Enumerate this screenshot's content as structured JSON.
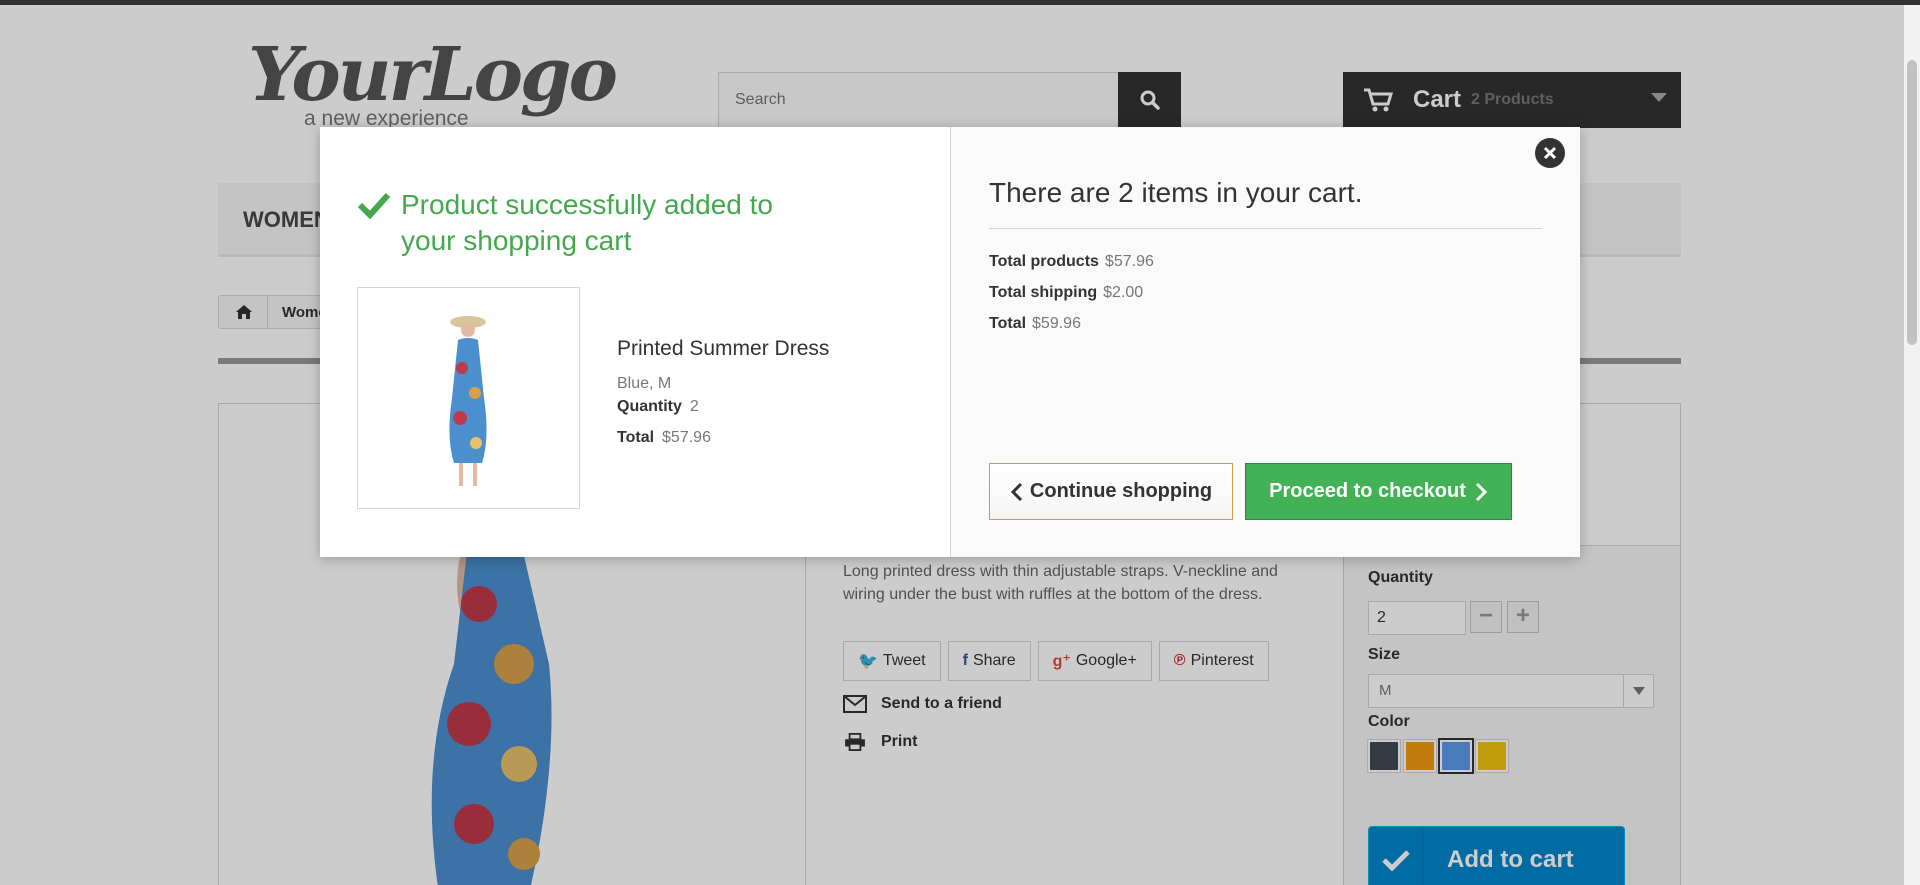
{
  "header": {
    "logo_script": "YourLogo",
    "logo_tagline": "a new experience",
    "search_placeholder": "Search",
    "cart_label": "Cart",
    "cart_count": "2 Products"
  },
  "menu": {
    "first_item": "WOMEN"
  },
  "breadcrumb": {
    "first_crumb": "Women"
  },
  "product": {
    "description": "Long printed dress with thin adjustable straps. V-neckline and wiring under the bust with ruffles at the bottom of the dress.",
    "social": [
      "Tweet",
      "Share",
      "Google+",
      "Pinterest"
    ],
    "send_friend": "Send to a friend",
    "print": "Print",
    "quantity_label": "Quantity",
    "quantity_value": "2",
    "size_label": "Size",
    "size_value": "M",
    "color_label": "Color",
    "colors": [
      "#434a54",
      "#f39c11",
      "#5d9cec",
      "#f1c40f"
    ],
    "add_to_cart": "Add to cart"
  },
  "modal": {
    "success_message": "Product successfully added to your shopping cart",
    "product_name": "Printed Summer Dress",
    "product_attributes": "Blue, M",
    "quantity_label": "Quantity",
    "quantity_value": "2",
    "total_label": "Total",
    "total_value": "$57.96",
    "cart_title": "There are 2 items in your cart.",
    "total_products_label": "Total products",
    "total_products_value": "$57.96",
    "total_shipping_label": "Total shipping",
    "total_shipping_value": "$2.00",
    "grand_total_label": "Total",
    "grand_total_value": "$59.96",
    "continue_label": "Continue shopping",
    "checkout_label": "Proceed to checkout"
  }
}
